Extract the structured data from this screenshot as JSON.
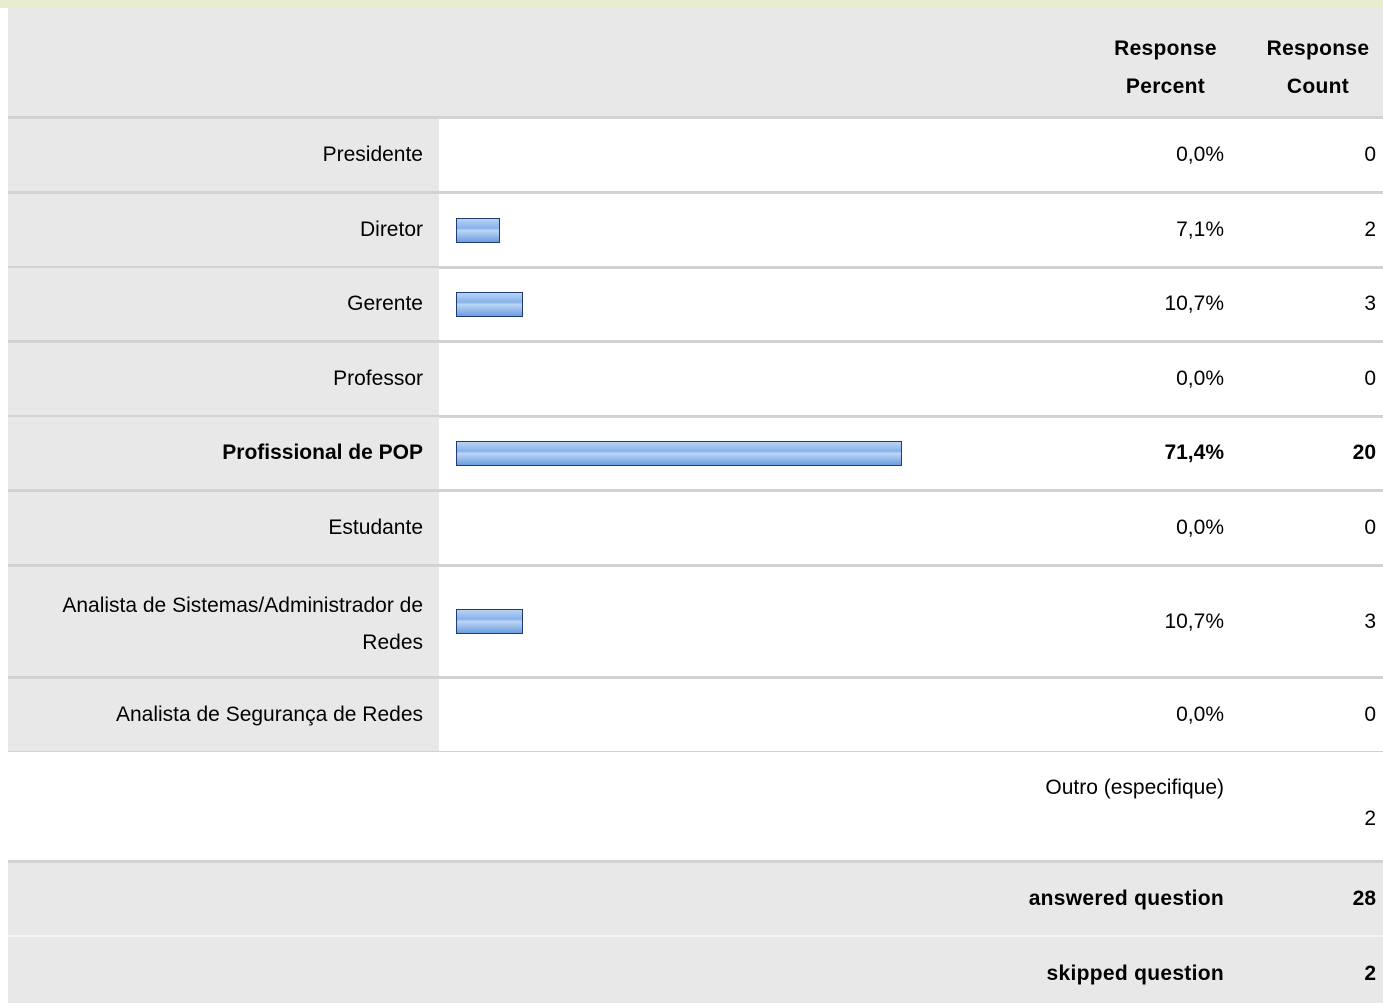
{
  "header": {
    "percent_label_1": "Response",
    "percent_label_2": "Percent",
    "count_label_1": "Response",
    "count_label_2": "Count"
  },
  "chart_data": {
    "type": "bar",
    "categories": [
      "Presidente",
      "Diretor",
      "Gerente",
      "Professor",
      "Profissional de POP",
      "Estudante",
      "Analista de Sistemas/Administrador de Redes",
      "Analista de Segurança de Redes"
    ],
    "percent_labels": [
      "0,0%",
      "7,1%",
      "10,7%",
      "0,0%",
      "71,4%",
      "0,0%",
      "10,7%",
      "0,0%"
    ],
    "values": [
      0.0,
      7.1,
      10.7,
      0.0,
      71.4,
      0.0,
      10.7,
      0.0
    ],
    "counts": [
      "0",
      "2",
      "3",
      "0",
      "20",
      "0",
      "3",
      "0"
    ],
    "highlight_index": 4,
    "xlim": [
      0,
      100
    ],
    "bar_color": "#88b2ea"
  },
  "other": {
    "label": "Outro (especifique)",
    "count": "2"
  },
  "footer": {
    "answered_label": "answered question",
    "answered_value": "28",
    "skipped_label": "skipped question",
    "skipped_value": "2"
  },
  "colors": {
    "header_bg": "#e8e8e8",
    "top_accent": "#e6edcf",
    "bar_border": "#213c75"
  }
}
